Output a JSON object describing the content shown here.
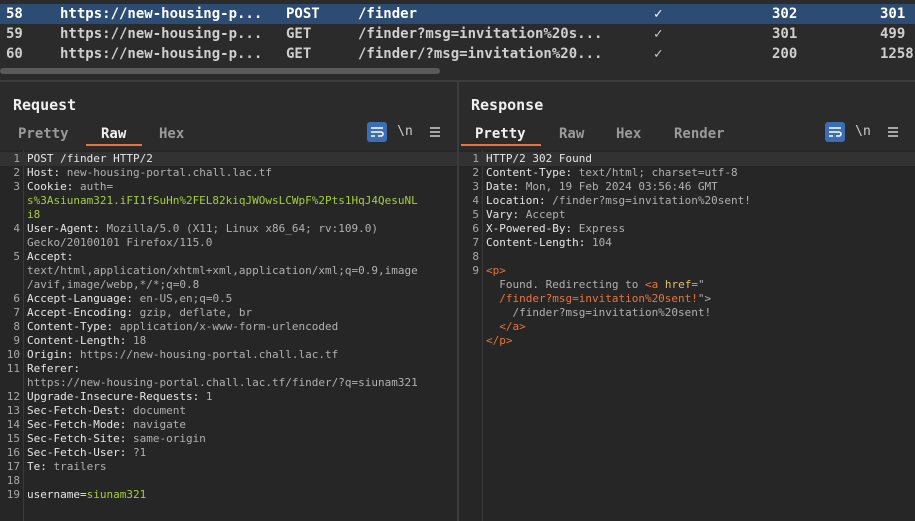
{
  "history": {
    "rows": [
      {
        "num": "58",
        "host": "https://new-housing-p...",
        "method": "POST",
        "url": "/finder",
        "check": "✓",
        "status": "302",
        "length": "301",
        "selected": true
      },
      {
        "num": "59",
        "host": "https://new-housing-p...",
        "method": "GET",
        "url": "/finder?msg=invitation%20s...",
        "check": "✓",
        "status": "301",
        "length": "499",
        "selected": false
      },
      {
        "num": "60",
        "host": "https://new-housing-p...",
        "method": "GET",
        "url": "/finder/?msg=invitation%20...",
        "check": "✓",
        "status": "200",
        "length": "1258",
        "selected": false
      }
    ]
  },
  "request": {
    "title": "Request",
    "tabs": [
      "Pretty",
      "Raw",
      "Hex"
    ],
    "active_tab": "Raw",
    "newline_label": "\\n",
    "lines": [
      {
        "n": "1",
        "parts": [
          [
            "k",
            "POST /finder HTTP/2"
          ]
        ]
      },
      {
        "n": "2",
        "parts": [
          [
            "k",
            "Host: "
          ],
          [
            "v",
            "new-housing-portal.chall.lac.tf"
          ]
        ]
      },
      {
        "n": "3",
        "parts": [
          [
            "k",
            "Cookie: "
          ],
          [
            "v",
            "auth="
          ]
        ]
      },
      {
        "n": "",
        "parts": [
          [
            "g",
            "s%3Asiunam321.iFI1fSuHn%2FEL82kiqJWOwsLCWpF%2Pts1HqJ4QesuNL"
          ]
        ]
      },
      {
        "n": "",
        "parts": [
          [
            "g",
            "i8"
          ]
        ]
      },
      {
        "n": "4",
        "parts": [
          [
            "k",
            "User-Agent: "
          ],
          [
            "v",
            "Mozilla/5.0 (X11; Linux x86_64; rv:109.0)"
          ]
        ]
      },
      {
        "n": "",
        "parts": [
          [
            "v",
            "Gecko/20100101 Firefox/115.0"
          ]
        ]
      },
      {
        "n": "5",
        "parts": [
          [
            "k",
            "Accept:"
          ]
        ]
      },
      {
        "n": "",
        "parts": [
          [
            "v",
            "text/html,application/xhtml+xml,application/xml;q=0.9,image"
          ]
        ]
      },
      {
        "n": "",
        "parts": [
          [
            "v",
            "/avif,image/webp,*/*;q=0.8"
          ]
        ]
      },
      {
        "n": "6",
        "parts": [
          [
            "k",
            "Accept-Language: "
          ],
          [
            "v",
            "en-US,en;q=0.5"
          ]
        ]
      },
      {
        "n": "7",
        "parts": [
          [
            "k",
            "Accept-Encoding: "
          ],
          [
            "v",
            "gzip, deflate, br"
          ]
        ]
      },
      {
        "n": "8",
        "parts": [
          [
            "k",
            "Content-Type: "
          ],
          [
            "v",
            "application/x-www-form-urlencoded"
          ]
        ]
      },
      {
        "n": "9",
        "parts": [
          [
            "k",
            "Content-Length: "
          ],
          [
            "v",
            "18"
          ]
        ]
      },
      {
        "n": "10",
        "parts": [
          [
            "k",
            "Origin: "
          ],
          [
            "v",
            "https://new-housing-portal.chall.lac.tf"
          ]
        ]
      },
      {
        "n": "11",
        "parts": [
          [
            "k",
            "Referer:"
          ]
        ]
      },
      {
        "n": "",
        "parts": [
          [
            "v",
            "https://new-housing-portal.chall.lac.tf/finder/?q=siunam321"
          ]
        ]
      },
      {
        "n": "12",
        "parts": [
          [
            "k",
            "Upgrade-Insecure-Requests: "
          ],
          [
            "v",
            "1"
          ]
        ]
      },
      {
        "n": "13",
        "parts": [
          [
            "k",
            "Sec-Fetch-Dest: "
          ],
          [
            "v",
            "document"
          ]
        ]
      },
      {
        "n": "14",
        "parts": [
          [
            "k",
            "Sec-Fetch-Mode: "
          ],
          [
            "v",
            "navigate"
          ]
        ]
      },
      {
        "n": "15",
        "parts": [
          [
            "k",
            "Sec-Fetch-Site: "
          ],
          [
            "v",
            "same-origin"
          ]
        ]
      },
      {
        "n": "16",
        "parts": [
          [
            "k",
            "Sec-Fetch-User: "
          ],
          [
            "v",
            "?1"
          ]
        ]
      },
      {
        "n": "17",
        "parts": [
          [
            "k",
            "Te: "
          ],
          [
            "v",
            "trailers"
          ]
        ]
      },
      {
        "n": "18",
        "parts": [
          [
            "k",
            ""
          ]
        ]
      },
      {
        "n": "19",
        "parts": [
          [
            "k",
            "username="
          ],
          [
            "g",
            "siunam321"
          ]
        ]
      }
    ]
  },
  "response": {
    "title": "Response",
    "tabs": [
      "Pretty",
      "Raw",
      "Hex",
      "Render"
    ],
    "active_tab": "Pretty",
    "newline_label": "\\n",
    "lines": [
      {
        "n": "1",
        "parts": [
          [
            "k",
            "HTTP/2 302 Found"
          ]
        ]
      },
      {
        "n": "2",
        "parts": [
          [
            "k",
            "Content-Type: "
          ],
          [
            "v",
            "text/html; charset=utf-8"
          ]
        ]
      },
      {
        "n": "3",
        "parts": [
          [
            "k",
            "Date: "
          ],
          [
            "v",
            "Mon, 19 Feb 2024 03:56:46 GMT"
          ]
        ]
      },
      {
        "n": "4",
        "parts": [
          [
            "k",
            "Location: "
          ],
          [
            "v",
            "/finder?msg=invitation%20sent!"
          ]
        ]
      },
      {
        "n": "5",
        "parts": [
          [
            "k",
            "Vary: "
          ],
          [
            "v",
            "Accept"
          ]
        ]
      },
      {
        "n": "6",
        "parts": [
          [
            "k",
            "X-Powered-By: "
          ],
          [
            "v",
            "Express"
          ]
        ]
      },
      {
        "n": "7",
        "parts": [
          [
            "k",
            "Content-Length: "
          ],
          [
            "v",
            "104"
          ]
        ]
      },
      {
        "n": "8",
        "parts": [
          [
            "k",
            ""
          ]
        ]
      },
      {
        "n": "9",
        "parts": [
          [
            "o",
            "<p>"
          ]
        ]
      },
      {
        "n": "",
        "parts": [
          [
            "v",
            "  Found. Redirecting to "
          ],
          [
            "o",
            "<a "
          ],
          [
            "y",
            "href"
          ],
          [
            "v",
            "=\""
          ]
        ]
      },
      {
        "n": "",
        "parts": [
          [
            "o",
            "  /finder?msg=invitation%20sent!"
          ],
          [
            "v",
            "\">"
          ]
        ]
      },
      {
        "n": "",
        "parts": [
          [
            "v",
            "    /finder?msg=invitation%20sent!"
          ]
        ]
      },
      {
        "n": "",
        "parts": [
          [
            "o",
            "  </a>"
          ]
        ]
      },
      {
        "n": "",
        "parts": [
          [
            "o",
            "</p>"
          ]
        ]
      }
    ]
  }
}
